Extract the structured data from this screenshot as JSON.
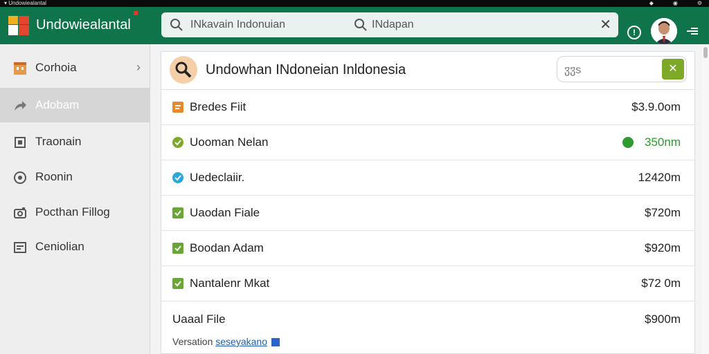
{
  "app": {
    "title": "Undowiealantal"
  },
  "search": {
    "query": "INkavain Indonuian",
    "secondary": "INdapan"
  },
  "sidebar": {
    "items": [
      {
        "label": "Corhoia",
        "icon": "building-icon",
        "has_chevron": true
      },
      {
        "label": "Adobam",
        "icon": "share-icon",
        "active": true
      },
      {
        "label": "Traonain",
        "icon": "square-icon"
      },
      {
        "label": "Roonin",
        "icon": "circle-icon"
      },
      {
        "label": "Pocthan Fillog",
        "icon": "camera-icon"
      },
      {
        "label": "Ceniolian",
        "icon": "card-icon"
      }
    ]
  },
  "panel": {
    "title": "Undowhan INdoneian Inldonesia",
    "mini_search_text": "ჳჳs",
    "rows": [
      {
        "name": "Bredes Fiit",
        "value": "$3.9.0om",
        "icon": "orange-square-icon",
        "color": "#e8892b"
      },
      {
        "name": "Uooman Nelan",
        "value": "350nm",
        "icon": "green-check-icon",
        "color": "#7ea928",
        "value_green": true
      },
      {
        "name": "Uedeclaiir.",
        "value": "12420m",
        "icon": "blue-check-icon",
        "color": "#2aa6dc"
      },
      {
        "name": "Uaodan Fiale",
        "value": "$720m",
        "icon": "green-square-icon",
        "color": "#6aa636"
      },
      {
        "name": "Boodan Adam",
        "value": "$920m",
        "icon": "green-square-icon",
        "color": "#6aa636"
      },
      {
        "name": "Nantalenr Mkat",
        "value": "$72 0m",
        "icon": "green-square-icon",
        "color": "#6aa636"
      }
    ],
    "last_row": {
      "name": "Uaaal File",
      "value": "$900m"
    },
    "version_label": "Versation",
    "version_link": "seseyakano"
  },
  "colors": {
    "appbar": "#10744a",
    "accent_green": "#7ea928"
  }
}
